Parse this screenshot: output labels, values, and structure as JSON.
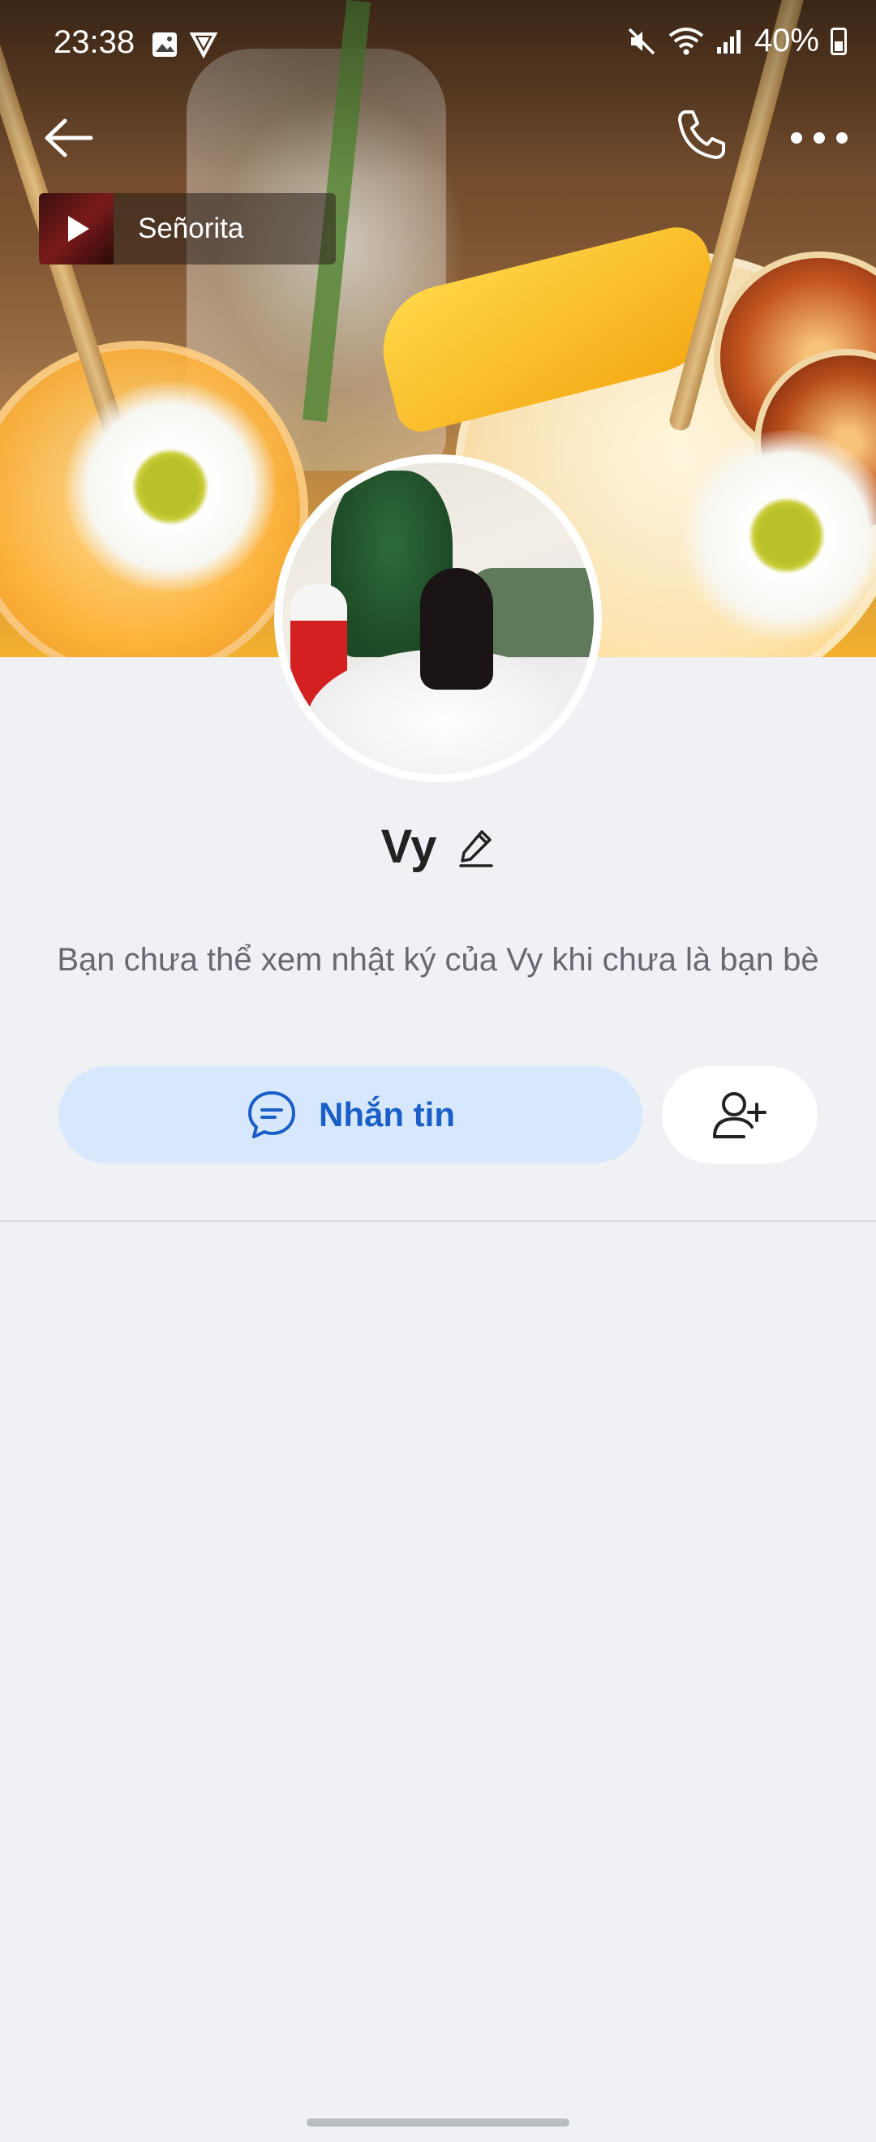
{
  "status_bar": {
    "time": "23:38",
    "battery": "40%"
  },
  "music": {
    "title": "Señorita"
  },
  "profile": {
    "name": "Vy",
    "notice": "Bạn chưa thể xem nhật ký của Vy khi chưa là bạn bè"
  },
  "actions": {
    "message_label": "Nhắn tin"
  },
  "colors": {
    "accent": "#1a5fc7",
    "message_bg": "#d8e8fc",
    "page_bg": "#f0f1f5"
  }
}
